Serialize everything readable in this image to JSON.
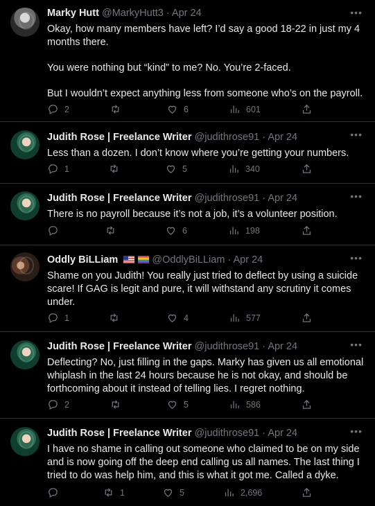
{
  "tweets": [
    {
      "name": "Marky Hutt",
      "handle": "@MarkyHutt3",
      "date": "Apr 24",
      "paragraphs": [
        "Okay, how many members have left? I’d say a good 18-22 in just my 4 months there.",
        "You were nothing but “kind” to me? No. You’re 2-faced.",
        "But I wouldn’t expect anything less from someone who’s on the payroll."
      ],
      "replies": "2",
      "retweets": "",
      "likes": "6",
      "views": "601"
    },
    {
      "name": "Judith Rose | Freelance Writer",
      "handle": "@judithrose91",
      "date": "Apr 24",
      "paragraphs": [
        "Less than a dozen. I don’t know where you’re getting your numbers."
      ],
      "replies": "1",
      "retweets": "",
      "likes": "5",
      "views": "340"
    },
    {
      "name": "Judith Rose | Freelance Writer",
      "handle": "@judithrose91",
      "date": "Apr 24",
      "paragraphs": [
        "There is no payroll because it’s not a job, it’s a volunteer position."
      ],
      "replies": "",
      "retweets": "",
      "likes": "6",
      "views": "198"
    },
    {
      "name": "Oddly BiLLiam",
      "handle": "@OddlyBiLLiam",
      "date": "Apr 24",
      "paragraphs": [
        "Shame on you Judith! You really just tried to deflect by using a suicide scare! If GAG is legit and pure, it will withstand any scrutiny it comes under."
      ],
      "replies": "1",
      "retweets": "",
      "likes": "4",
      "views": "577"
    },
    {
      "name": "Judith Rose | Freelance Writer",
      "handle": "@judithrose91",
      "date": "Apr 24",
      "paragraphs": [
        "Deflecting? No, just filling in the gaps. Marky has given us all emotional whiplash in the last 24 hours because he is not okay, and should be forthcoming about it instead of telling lies. I regret nothing."
      ],
      "replies": "2",
      "retweets": "",
      "likes": "5",
      "views": "586"
    },
    {
      "name": "Judith Rose | Freelance Writer",
      "handle": "@judithrose91",
      "date": "Apr 24",
      "paragraphs": [
        "I have no shame in calling out someone who claimed to be on my side and is now going off the deep end calling us all names. The last thing I tried to do was help him, and this is what it got me. Called a dyke."
      ],
      "replies": "",
      "retweets": "1",
      "likes": "5",
      "views": "2,696"
    }
  ],
  "icons": {
    "reply": "reply-icon",
    "retweet": "retweet-icon",
    "like": "heart-icon",
    "views": "views-icon",
    "share": "share-icon",
    "more": "more-icon"
  },
  "colors": {
    "background": "#000000",
    "text": "#e7e9ea",
    "secondary": "#71767b",
    "divider": "#2f3336"
  }
}
